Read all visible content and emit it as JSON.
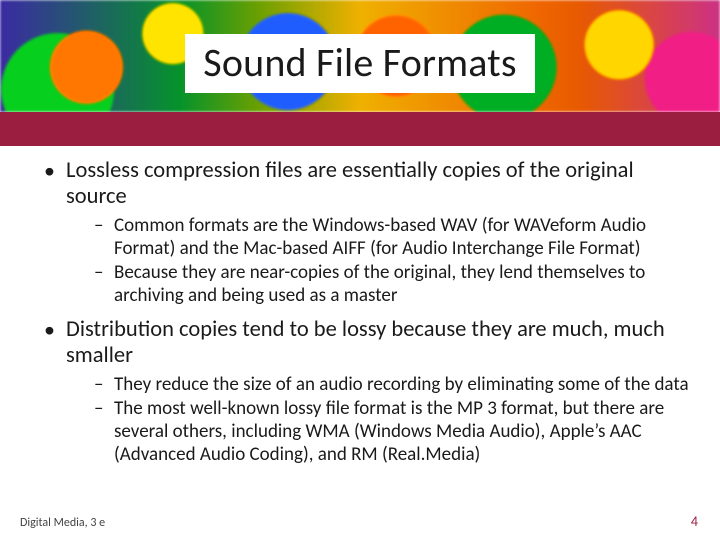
{
  "title": "Sound File Formats",
  "bullets": [
    {
      "text": "Lossless compression files are essentially copies of the original source",
      "sub": [
        "Common formats are the Windows-based WAV (for WAVeform Audio Format) and the Mac-based AIFF (for Audio Interchange File Format)",
        "Because they are near-copies of the original, they lend themselves to archiving and being used as a master"
      ]
    },
    {
      "text": "Distribution copies tend to be lossy because they are much, much smaller",
      "sub": [
        "They reduce the size of an audio recording by eliminating some of the data",
        "The most well-known lossy file format is the MP 3 format, but there are several others, including WMA (Windows Media Audio), Apple’s AAC (Advanced Audio Coding), and RM (Real.Media)"
      ]
    }
  ],
  "footer": {
    "left": "Digital Media, 3 e",
    "right": "4"
  }
}
